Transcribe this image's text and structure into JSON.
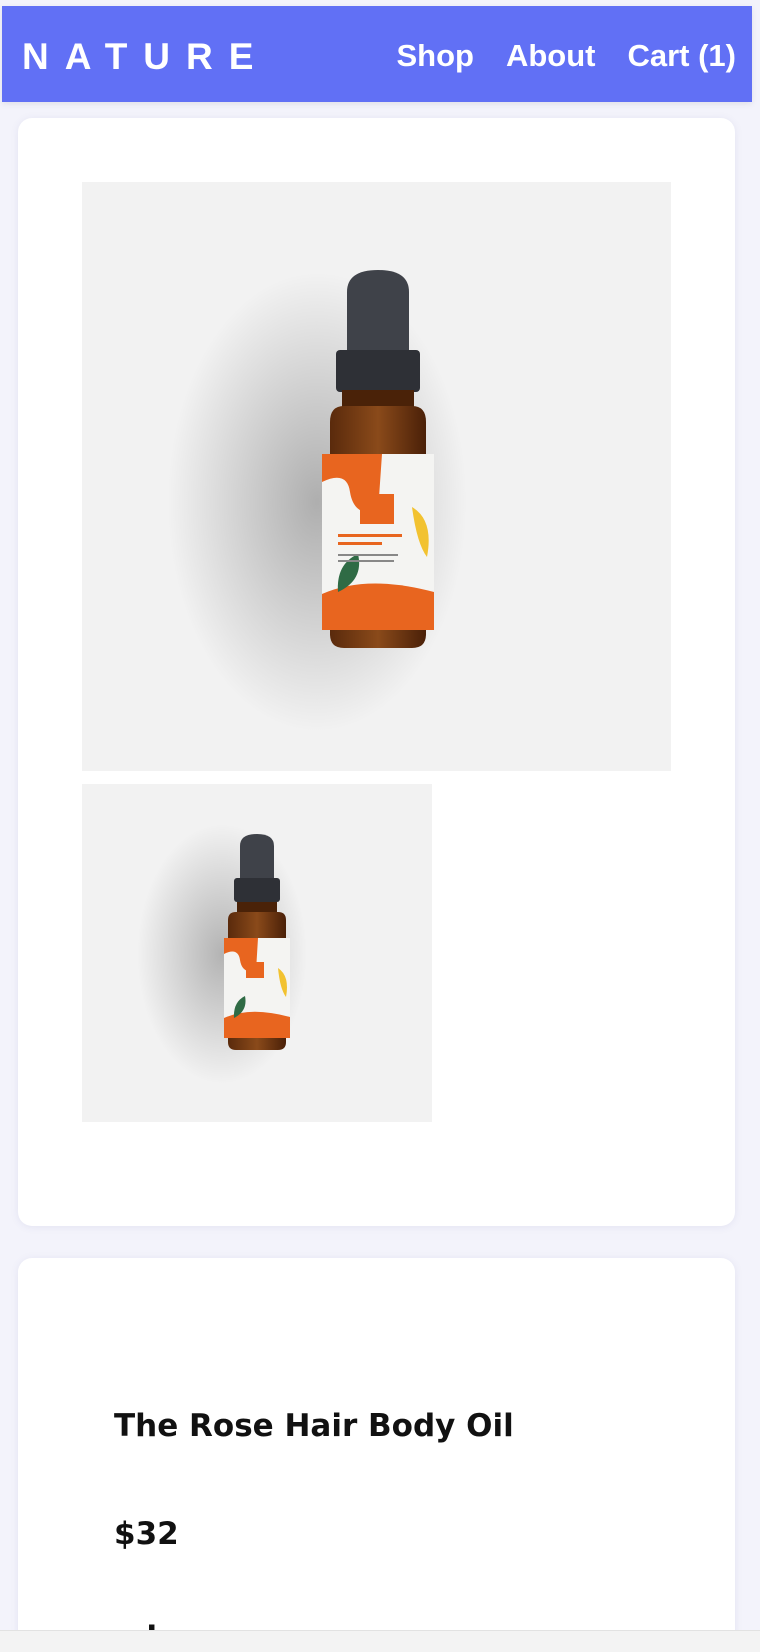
{
  "header": {
    "brand": "NATURE",
    "nav": [
      {
        "label": "Shop"
      },
      {
        "label": "About"
      },
      {
        "label": "Cart (1)"
      }
    ]
  },
  "product": {
    "title": "The Rose Hair Body Oil",
    "price": "$32",
    "partial_heading": "ad:"
  },
  "gallery": {
    "main_image_icon": "serum-bottle-photo",
    "thumbnail_icon": "serum-bottle-thumbnail"
  },
  "colors": {
    "nav_bg": "#6170f5",
    "card_bg": "#ffffff",
    "page_bg": "#f3f3fb",
    "label_orange": "#e8651f",
    "leaf_green": "#2f6b45"
  }
}
